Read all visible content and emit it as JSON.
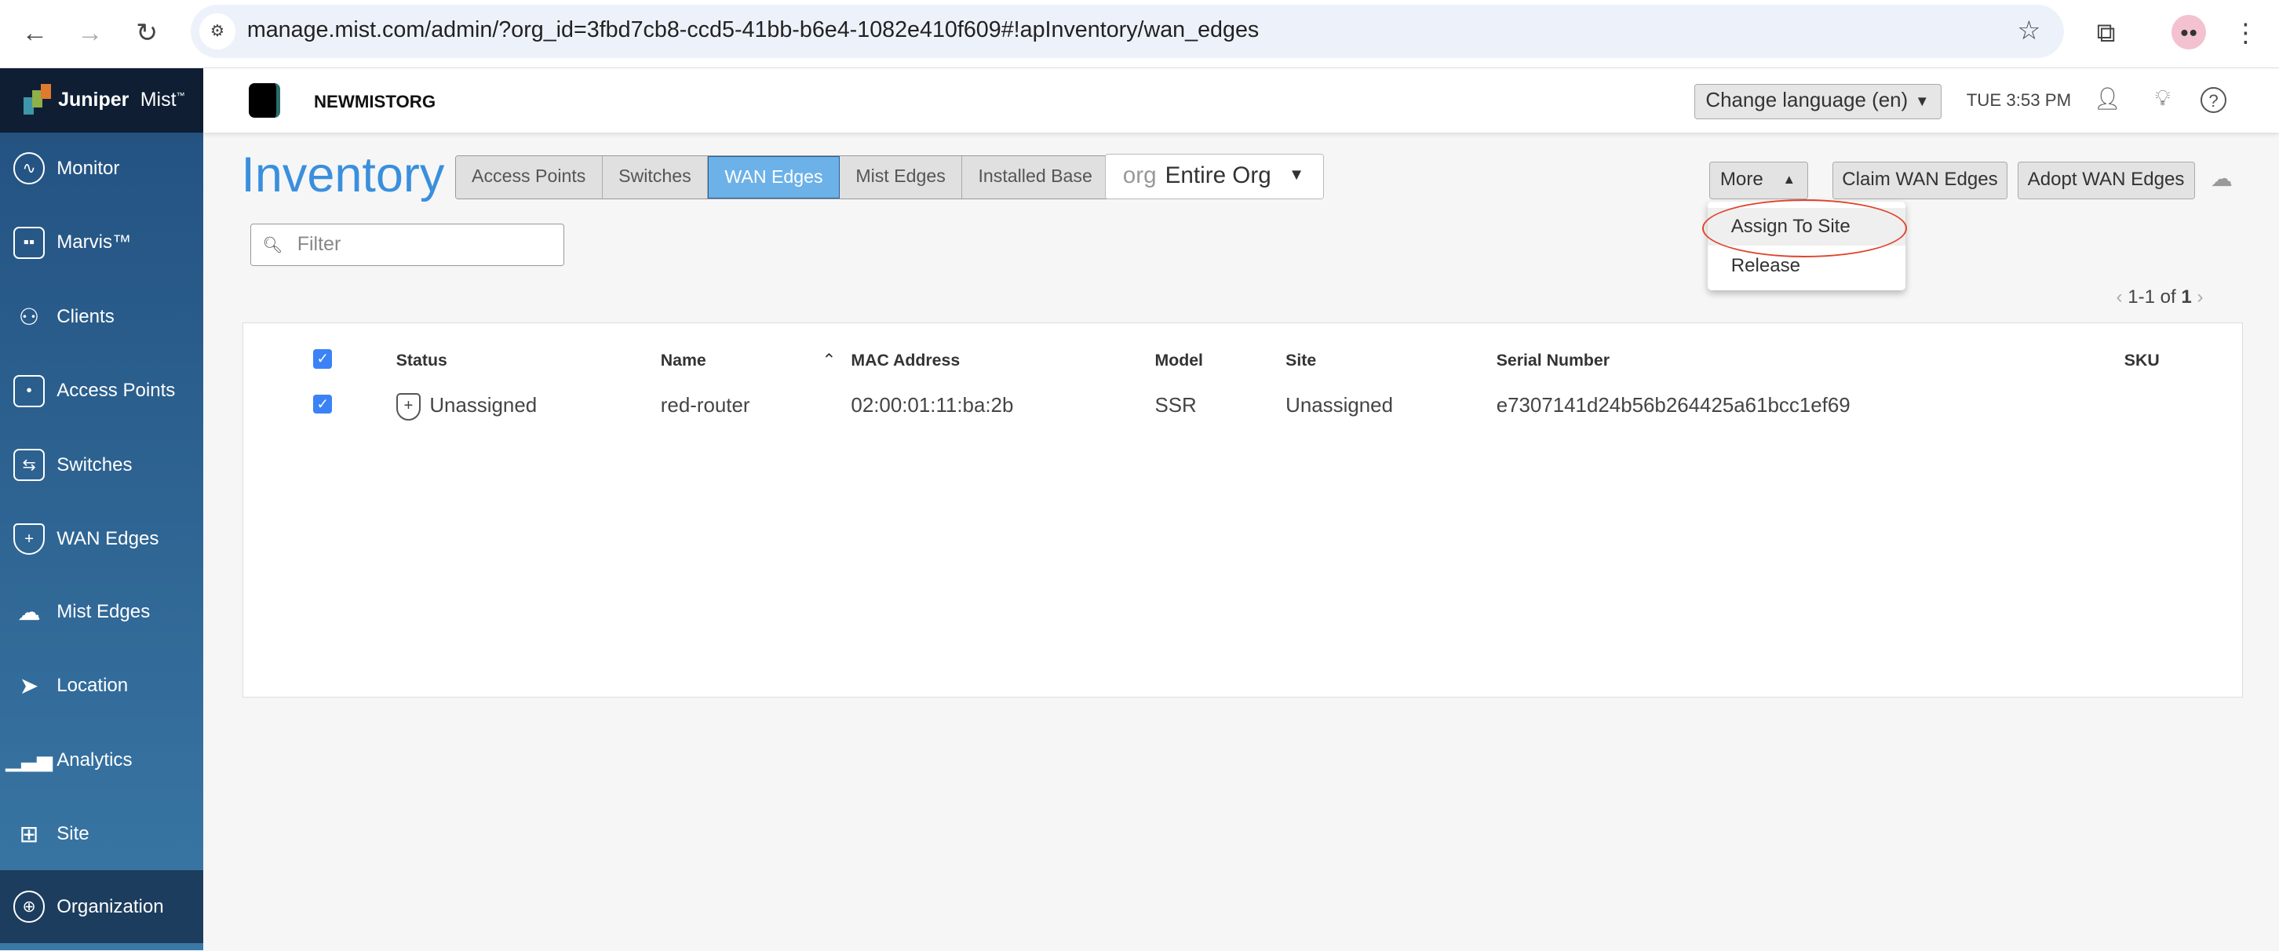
{
  "browser": {
    "url": "manage.mist.com/admin/?org_id=3fbd7cb8-ccd5-41bb-b6e4-1082e410f609#!apInventory/wan_edges"
  },
  "brand": {
    "logo_text": "Juniper Mist™",
    "colors": {
      "sidebar": "#22507f",
      "accent": "#3a8fdd",
      "highlight": "#e0442b"
    }
  },
  "sidebar": {
    "items": [
      {
        "label": "Monitor",
        "icon": "pulse-icon"
      },
      {
        "label": "Marvis™",
        "icon": "marvis-icon"
      },
      {
        "label": "Clients",
        "icon": "clients-icon"
      },
      {
        "label": "Access Points",
        "icon": "access-point-icon"
      },
      {
        "label": "Switches",
        "icon": "switch-icon"
      },
      {
        "label": "WAN Edges",
        "icon": "wan-edge-icon"
      },
      {
        "label": "Mist Edges",
        "icon": "cloud-icon"
      },
      {
        "label": "Location",
        "icon": "location-icon"
      },
      {
        "label": "Analytics",
        "icon": "analytics-icon"
      },
      {
        "label": "Site",
        "icon": "site-icon"
      },
      {
        "label": "Organization",
        "icon": "globe-icon"
      }
    ]
  },
  "header": {
    "org_name": "NEWMISTORG",
    "language": "Change language (en)",
    "time": "TUE 3:53 PM"
  },
  "page": {
    "title": "Inventory",
    "tabs": [
      "Access Points",
      "Switches",
      "WAN Edges",
      "Mist Edges",
      "Installed Base"
    ],
    "scope_prefix": "org",
    "scope_value": "Entire Org",
    "filter_placeholder": "Filter",
    "more_label": "More",
    "claim_label": "Claim WAN Edges",
    "adopt_label": "Adopt WAN Edges",
    "menu": [
      "Assign To Site",
      "Release"
    ],
    "pager": "1-1 of ",
    "pager_total": "1"
  },
  "table": {
    "headers": [
      "Status",
      "Name",
      "MAC Address",
      "Model",
      "Site",
      "Serial Number",
      "SKU"
    ],
    "rows": [
      {
        "status": "Unassigned",
        "name": "red-router",
        "mac": "02:00:01:11:ba:2b",
        "model": "SSR",
        "site": "Unassigned",
        "serial": "e7307141d24b56b264425a61bcc1ef69",
        "sku": ""
      }
    ]
  }
}
